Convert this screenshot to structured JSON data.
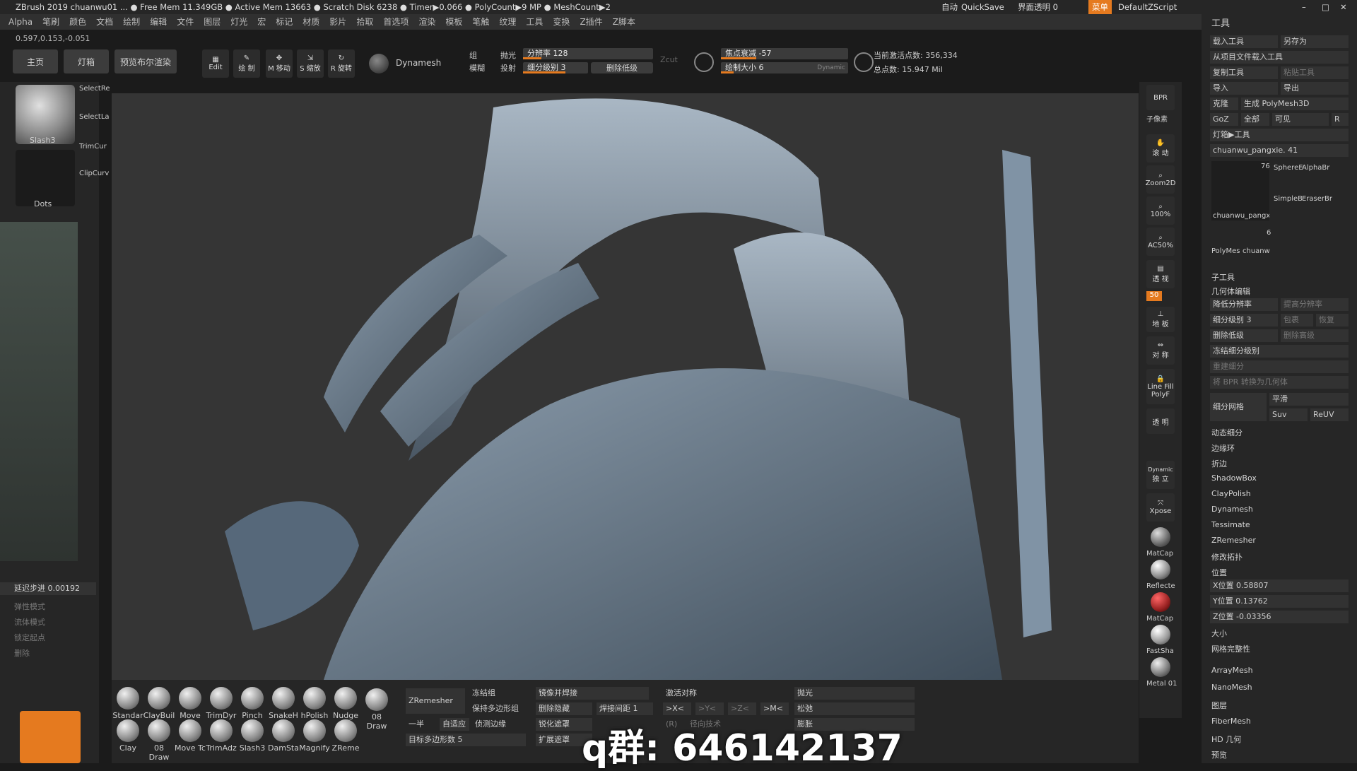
{
  "titlebar": {
    "text": "ZBrush 2019  chuanwu01 ... ● Free Mem 11.349GB ● Active Mem 13663 ● Scratch Disk 6238 ● Timer▶0.066 ● PolyCount▶9 MP ● MeshCount▶2",
    "auto": "自动",
    "quicksave": "QuickSave",
    "transparency": "界面透明 0",
    "menu": "菜单",
    "script": "DefaultZScript"
  },
  "menus": [
    "Alpha",
    "笔刷",
    "颜色",
    "文档",
    "绘制",
    "编辑",
    "文件",
    "图层",
    "灯光",
    "宏",
    "标记",
    "材质",
    "影片",
    "拾取",
    "首选项",
    "渲染",
    "模板",
    "笔触",
    "纹理",
    "工具",
    "变换",
    "Z插件",
    "Z脚本"
  ],
  "coords": "0.597,0.153,-0.051",
  "shelf": {
    "home": "主页",
    "light": "灯箱",
    "preview": "预览布尔渲染",
    "edit": "Edit",
    "draw": "绘 制",
    "move": "M 移动",
    "scale": "S 缩放",
    "rotate": "R 旋转",
    "dynamesh": "Dynamesh",
    "group": "组",
    "blur": "模糊",
    "polish": "抛光",
    "project": "投射",
    "resolution": "分辨率 128",
    "subdiv": "细分级别 3",
    "dellower": "删除低级",
    "zcut": "Zcut",
    "focal": "焦点衰减 -57",
    "drawsize": "绘制大小 6",
    "dynamic": "Dynamic",
    "active_points": "当前激活点数: 356,334",
    "total_points": "总点数: 15.947 Mil"
  },
  "left": {
    "brush": "Slash3",
    "stroke": "Dots",
    "selectrect": "SelectRe",
    "selectlasso": "SelectLa",
    "trimcurve": "TrimCur",
    "clipcurve": "ClipCurv",
    "lazy": "延迟步进 0.00192",
    "opts": [
      "弹性模式",
      "流体模式",
      "锁定起点",
      "删除"
    ]
  },
  "rightstrip": [
    "BPR",
    "子像素",
    "滚 动",
    "Zoom2D",
    "100%",
    "AC50%",
    "透 视",
    "50",
    "地 板",
    "对 称",
    "PolyF",
    "Line Fill",
    "透 明",
    "Dynamic",
    "独 立",
    "Xpose",
    "MatCap",
    "Reflecte",
    "MatCap",
    "FastSha",
    "Metal 01"
  ],
  "rightpanel": {
    "title": "工具",
    "rows": [
      "载入工具",
      "另存为",
      "从项目文件载入工具",
      "复制工具",
      "粘贴工具",
      "导入",
      "导出",
      "克隆",
      "生成 PolyMesh3D",
      "GoZ",
      "全部",
      "可见",
      "R",
      "灯箱▶工具"
    ],
    "toolname": "chuanwu_pangxie. 41",
    "thumbs": [
      "chuanwu_pangx",
      "SphereE",
      "AlphaBr",
      "SimpleB",
      "EraserBr",
      "PolyMes",
      "chuanw"
    ],
    "num76": "76",
    "num6": "6",
    "subtool": "子工具",
    "geo": "几何体编辑",
    "lower": "降低分辨率",
    "higher": "提高分辨率",
    "sdiv": "细分级别 3",
    "cage": "包裹",
    "reconst": "恢复",
    "dellower": "删除低级",
    "delhigher": "删除高级",
    "freeze": "冻结细分级别",
    "rebuild": "重建细分",
    "bpr2geo": "将 BPR 转换为几何体",
    "divide": "细分网格",
    "smooth": "平滑",
    "suv": "Suv",
    "reuv": "ReUV",
    "items": [
      "动态细分",
      "边缘环",
      "折边",
      "ShadowBox",
      "ClayPolish",
      "Dynamesh",
      "Tessimate",
      "ZRemesher",
      "修改拓扑"
    ],
    "position": "位置",
    "xpos": "X位置 0.58807",
    "ypos": "Y位置 0.13762",
    "zpos": "Z位置 -0.03356",
    "size": "大小",
    "mesh_integrity": "网格完整性",
    "more": [
      "ArrayMesh",
      "NanoMesh",
      "图层",
      "FiberMesh",
      "HD 几何",
      "预览"
    ]
  },
  "bottom": {
    "brushes1": [
      "Standar",
      "ClayBuil",
      "Move",
      "TrimDyr",
      "Pinch",
      "SnakeH",
      "hPolish",
      "Nudge",
      "08 Draw"
    ],
    "brushes2": [
      "Clay",
      "08 Draw",
      "Move Tc",
      "TrimAdz",
      "Slash3",
      "DamSta",
      "Magnify",
      "ZReme"
    ],
    "zremesher": "ZRemesher",
    "freeze_groups": "冻结组",
    "keep_groups": "保持多边形组",
    "half": "一半",
    "adapt": "自适应",
    "detect_edges": "侦测边缘",
    "target": "目标多边形数 5",
    "mirror_weld": "镜像并焊接",
    "del_hidden": "删除隐藏",
    "weld_dist": "焊接间距 1",
    "sharpen": "锐化遮罩",
    "expand": "扩展遮罩",
    "activate_sym": "激活对称",
    "x": ">X<",
    "y": ">Y<",
    "z": ">Z<",
    "m": ">M<",
    "polish": "抛光",
    "relax": "松弛",
    "inflate": "膨胀",
    "r": "(R)",
    "radial": "径向技术"
  },
  "watermark": "q群: 646142137"
}
